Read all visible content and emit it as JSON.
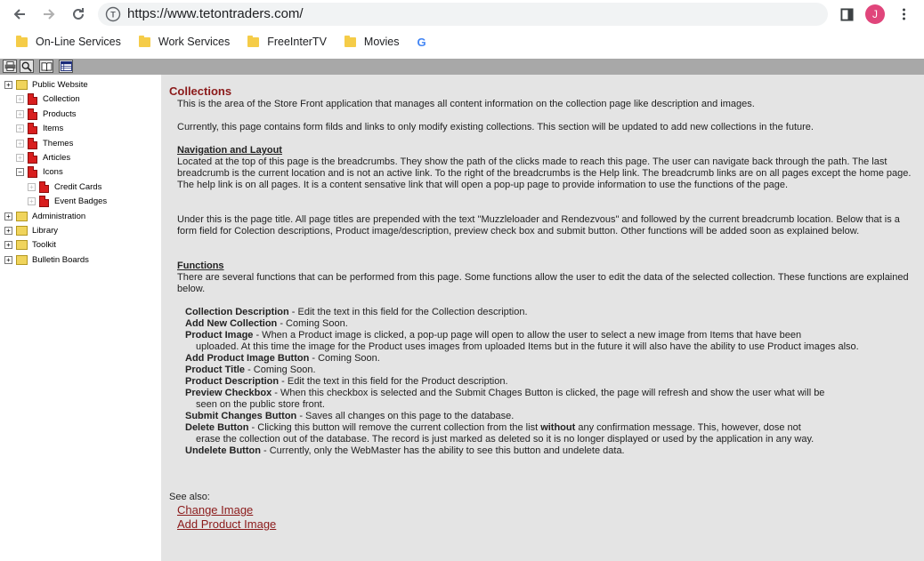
{
  "browser": {
    "url": "https://www.tetontraders.com/",
    "profile_initial": "J",
    "bookmarks": [
      "On-Line Services",
      "Work Services",
      "FreeInterTV",
      "Movies"
    ],
    "google_logo": "G"
  },
  "toolbar": {
    "icons": [
      "printer-icon",
      "search-icon",
      "book-icon",
      "table-icon"
    ]
  },
  "sidebar": {
    "items": [
      {
        "label": "Public Website",
        "expander": "+",
        "type": "folder"
      },
      {
        "label": "Collection",
        "expander": "+",
        "type": "doc"
      },
      {
        "label": "Products",
        "expander": "+",
        "type": "doc"
      },
      {
        "label": "Items",
        "expander": "+",
        "type": "doc"
      },
      {
        "label": "Themes",
        "expander": "+",
        "type": "doc"
      },
      {
        "label": "Articles",
        "expander": "+",
        "type": "doc"
      },
      {
        "label": "Icons",
        "expander": "−",
        "type": "doc"
      },
      {
        "label": "Credit Cards",
        "expander": "+",
        "type": "doc"
      },
      {
        "label": "Event Badges",
        "expander": "+",
        "type": "doc"
      },
      {
        "label": "Administration",
        "expander": "+",
        "type": "folder"
      },
      {
        "label": "Library",
        "expander": "+",
        "type": "folder"
      },
      {
        "label": "Toolkit",
        "expander": "+",
        "type": "folder"
      },
      {
        "label": "Bulletin Boards",
        "expander": "+",
        "type": "folder"
      }
    ]
  },
  "content": {
    "title": "Collections",
    "intro1": "This is the area of the Store Front application that manages all content information on the collection page like description and images.",
    "intro2": "Currently, this page contains form filds and links to only modify existing collections. This section will be updated to add new collections in the future.",
    "nav_heading": "Navigation and Layout",
    "nav_text": "Located at the top of this page is the breadcrumbs. They show the path of the clicks made to reach this page. The user can navigate back through the path. The last breadcrumb is the current location and is not an active link. To the right of the breadcrumbs is the Help link. The breadcrumb links are on all pages except the home page. The help link is on all pages. It is a content sensative link that will open a pop-up page to provide information to use the functions of the page.",
    "nav_text2": "Under this is the page title. All page titles are prepended with the text \"Muzzleloader and Rendezvous\" and followed by the current breadcrumb location. Below that is a form field for Colection descriptions, Product image/description, preview check box and submit button. Other functions will be added soon as explained below.",
    "func_heading": "Functions",
    "func_intro": "There are several functions that can be performed from this page. Some functions allow the user to edit the data of the selected collection. These functions are explained below.",
    "functions": [
      {
        "name": "Collection Description",
        "desc": " - Edit the text in this field for the Collection description."
      },
      {
        "name": "Add New Collection",
        "desc": " - Coming Soon."
      },
      {
        "name": "Product Image",
        "desc": " - When a Product image is clicked, a pop-up page will open to allow the user to select a new image from Items that have been",
        "cont": "uploaded. At this time the image for the Product uses images from uploaded Items but in the future it will also have the ability to use Product images also."
      },
      {
        "name": "Add Product Image Button",
        "desc": " - Coming Soon."
      },
      {
        "name": "Product Title",
        "desc": " - Coming Soon."
      },
      {
        "name": "Product Description",
        "desc": " - Edit the text in this field for the Product description."
      },
      {
        "name": "Preview Checkbox",
        "desc": " - When this checkbox is selected and the Submit Chages Button is clicked, the page will refresh and show the user what will be",
        "cont": "seen on the public store front."
      },
      {
        "name": "Submit Changes Button",
        "desc": " - Saves all changes on this page to the database."
      },
      {
        "name": "Delete Button",
        "desc": " - Clicking this button will remove the current collection from the list ",
        "bold_word": "without",
        "desc2": " any confirmation message. This, however, dose not",
        "cont": "erase the collection out of the database. The record is just marked as deleted so it is no longer displayed or used by the application in any way."
      },
      {
        "name": "Undelete Button",
        "desc": " - Currently, only the WebMaster has the ability to see this button and undelete data."
      }
    ],
    "see_also": "See also:",
    "links": [
      "Change Image",
      "Add Product Image"
    ]
  }
}
